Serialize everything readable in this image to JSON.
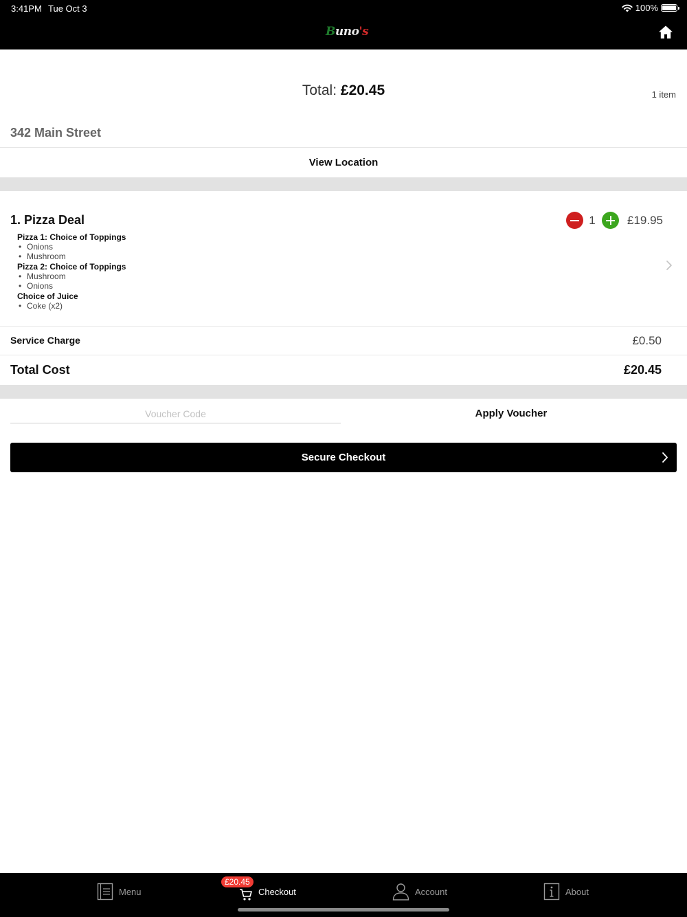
{
  "status_bar": {
    "time": "3:41PM",
    "date": "Tue Oct 3",
    "battery": "100%"
  },
  "header": {
    "logo_text": [
      "B",
      "uno",
      "'s"
    ],
    "home_icon": "home-icon"
  },
  "order_summary": {
    "total_label": "Total: ",
    "total_value": "£20.45",
    "item_count": "1 item"
  },
  "location": {
    "address": "342 Main Street",
    "view_location_label": "View Location"
  },
  "cart": {
    "items": [
      {
        "title": "1. Pizza Deal",
        "quantity": "1",
        "price": "£19.95",
        "options": [
          {
            "group": "Pizza 1: Choice of Toppings",
            "choices": [
              "Onions",
              "Mushroom"
            ]
          },
          {
            "group": "Pizza 2: Choice of Toppings",
            "choices": [
              "Mushroom",
              "Onions"
            ]
          },
          {
            "group": "Choice of Juice",
            "choices": [
              "Coke (x2)"
            ]
          }
        ]
      }
    ],
    "service_charge_label": "Service Charge",
    "service_charge_value": "£0.50",
    "total_cost_label": "Total Cost",
    "total_cost_value": "£20.45"
  },
  "voucher": {
    "placeholder": "Voucher Code",
    "apply_label": "Apply Voucher"
  },
  "checkout": {
    "button_label": "Secure Checkout"
  },
  "tab_bar": {
    "tabs": [
      {
        "label": "Menu",
        "icon": "menu-book-icon",
        "active": false
      },
      {
        "label": "Checkout",
        "icon": "cart-icon",
        "active": true,
        "badge": "£20.45"
      },
      {
        "label": "Account",
        "icon": "person-icon",
        "active": false
      },
      {
        "label": "About",
        "icon": "info-icon",
        "active": false
      }
    ]
  },
  "colors": {
    "bar_background": "#000000",
    "minus_button": "#cf1f1f",
    "plus_button": "#3ca61e",
    "badge": "#f03b33",
    "band_gray": "#e2e2e2"
  }
}
